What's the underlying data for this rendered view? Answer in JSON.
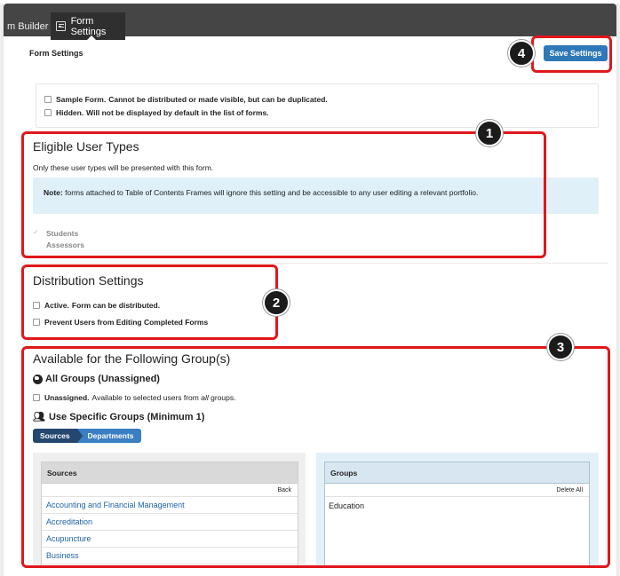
{
  "tabs": {
    "builder": "m Builder",
    "settings": "Form Settings"
  },
  "page_title": "Form Settings",
  "save_button": "Save Settings",
  "badges": [
    "1",
    "2",
    "3",
    "4"
  ],
  "options": {
    "sample_bold": "Sample Form.",
    "sample_rest": "Cannot be distributed or made visible, but can be duplicated.",
    "hidden_bold": "Hidden.",
    "hidden_rest": "Will not be displayed by default in the list of forms."
  },
  "eligible": {
    "title": "Eligible User Types",
    "subtitle": "Only these user types will be presented with this form.",
    "note_label": "Note:",
    "note_text": "forms attached to Table of Contents Frames will ignore this setting and be accessible to any user editing a relevant portfolio.",
    "check_mark": "✓",
    "students": "Students",
    "assessors": "Assessors"
  },
  "distribution": {
    "title": "Distribution Settings",
    "active_bold": "Active.",
    "active_rest": "Form can be distributed.",
    "prevent": "Prevent Users from Editing Completed Forms"
  },
  "available": {
    "title": "Available for the Following Group(s)",
    "all_groups": "All Groups (Unassigned)",
    "unassigned_bold": "Unassigned.",
    "unassigned_pre": "Available to selected users from",
    "unassigned_em": "all",
    "unassigned_post": "groups.",
    "specific": "Use Specific Groups (Minimum 1)",
    "crumb_sources": "Sources",
    "crumb_departments": "Departments"
  },
  "sources_list": {
    "header": "Sources",
    "back": "Back",
    "items": [
      "Accounting and Financial Management",
      "Accreditation",
      "Acupuncture",
      "Business"
    ]
  },
  "groups_list": {
    "header": "Groups",
    "delete_all": "Delete All",
    "items": [
      "Education"
    ]
  },
  "colors": {
    "highlight": "#e0171c",
    "primary_button": "#2d78b8",
    "link": "#1e63a8",
    "topbar": "#454545"
  }
}
